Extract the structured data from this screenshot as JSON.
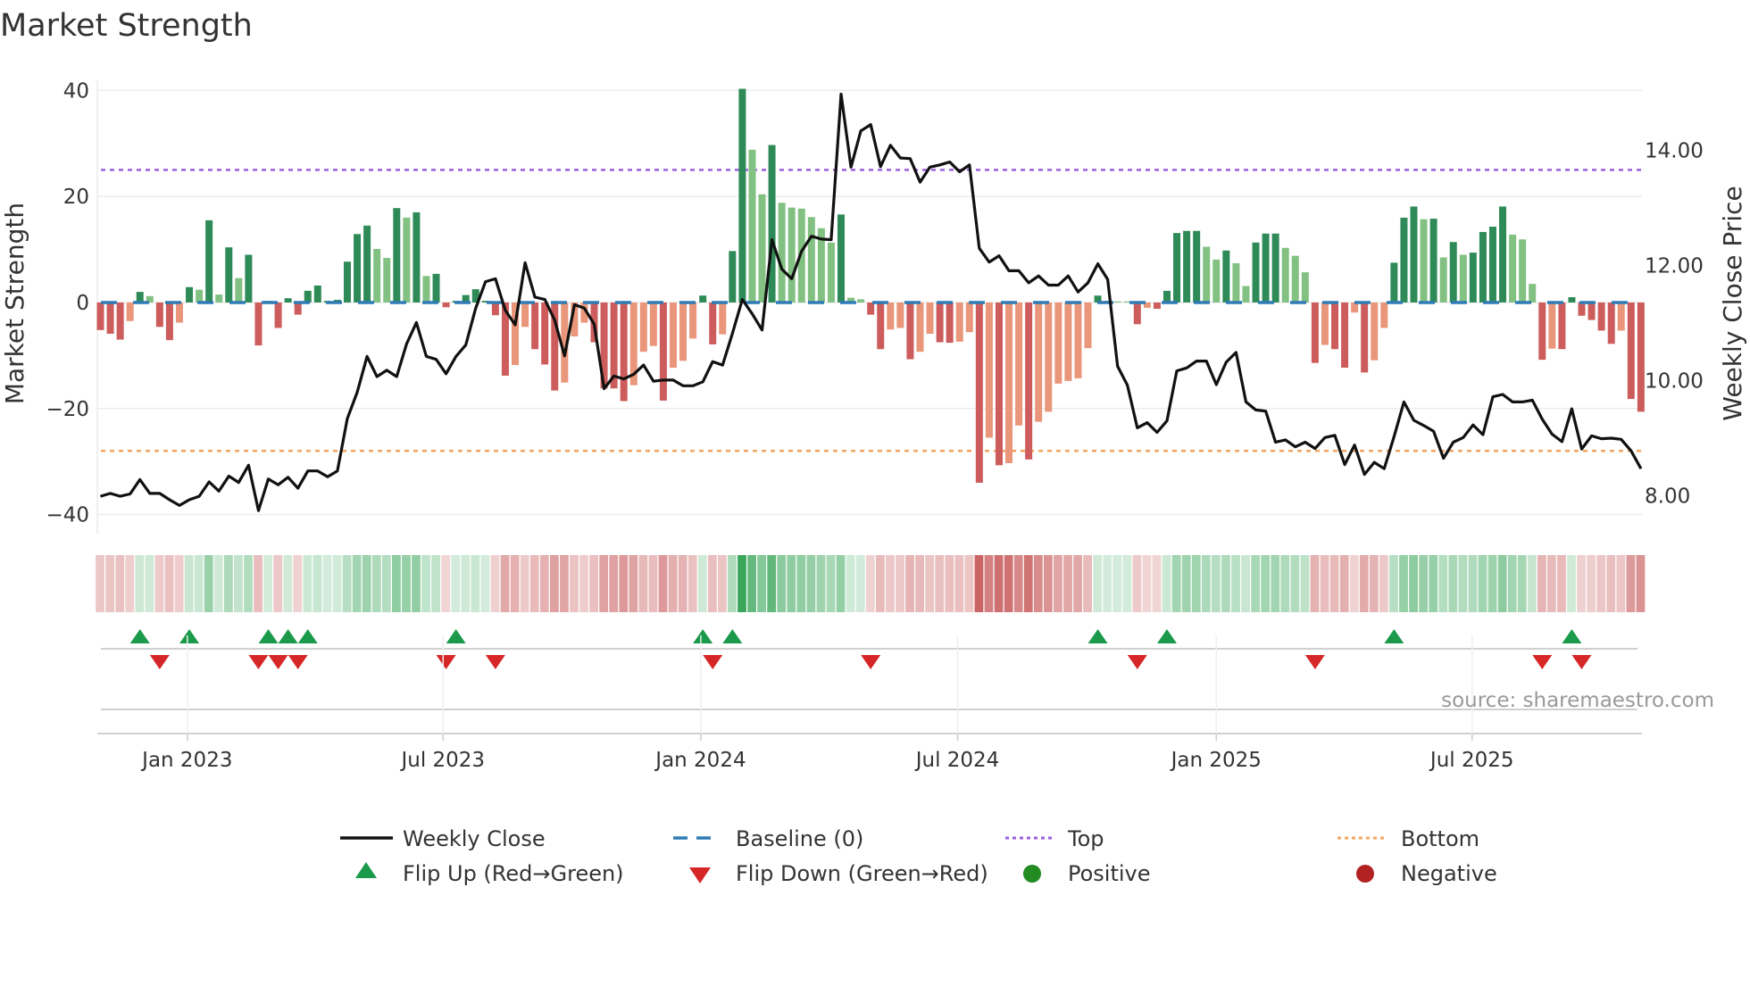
{
  "chart_data": {
    "type": "bar+line",
    "title": "Market Strength",
    "ylabel": "Market Strength",
    "y2label": "Weekly Close Price",
    "ylim": [
      -43.6,
      41.9
    ],
    "y2lim": [
      7.34,
      15.22
    ],
    "yticks": [
      {
        "v": 40,
        "label": "40"
      },
      {
        "v": 20,
        "label": "20"
      },
      {
        "v": 0,
        "label": "0"
      },
      {
        "v": -20,
        "label": "−20"
      },
      {
        "v": -40,
        "label": "−40"
      }
    ],
    "y2ticks": [
      {
        "v": 14,
        "label": "14.00"
      },
      {
        "v": 12,
        "label": "12.00"
      },
      {
        "v": 10,
        "label": "10.00"
      },
      {
        "v": 8,
        "label": "8.00"
      }
    ],
    "x_unit": "week index",
    "xticks": [
      {
        "week": 8.8,
        "label": "Jan 2023"
      },
      {
        "week": 34.7,
        "label": "Jul 2023"
      },
      {
        "week": 60.8,
        "label": "Jan 2024"
      },
      {
        "week": 86.8,
        "label": "Jul 2024"
      },
      {
        "week": 113.0,
        "label": "Jan 2025"
      },
      {
        "week": 138.9,
        "label": "Jul 2025"
      }
    ],
    "top_level": 25,
    "bottom_level": -28,
    "baseline": 0,
    "strength": [
      -5.2,
      -5.9,
      -7,
      -3.5,
      2,
      1.2,
      -4.6,
      -7.1,
      -3.8,
      2.9,
      2.4,
      15.5,
      1.5,
      10.4,
      4.6,
      9,
      -8.1,
      0.3,
      -4.8,
      0.8,
      -2.3,
      2.2,
      3.2,
      0.3,
      0.5,
      7.7,
      12.9,
      14.5,
      10.1,
      8.4,
      17.8,
      16,
      17,
      5,
      5.4,
      -0.9,
      0.3,
      1.4,
      2.5,
      0.3,
      -2.4,
      -13.8,
      -11.8,
      -4.6,
      -8.8,
      -11.7,
      -16.6,
      -15.1,
      -6.4,
      -3.8,
      -7.5,
      -16.2,
      -16.2,
      -18.6,
      -15.6,
      -9.3,
      -8.2,
      -18.5,
      -12.3,
      -11,
      -6.8,
      1.3,
      -7.9,
      -6,
      9.7,
      40.3,
      28.8,
      20.4,
      29.7,
      18.8,
      17.9,
      17.7,
      16.1,
      14,
      11.3,
      16.6,
      0.9,
      0.6,
      -2.3,
      -8.8,
      -5.1,
      -4.8,
      -10.7,
      -9.3,
      -5.9,
      -7.5,
      -7.6,
      -7.4,
      -5.6,
      -34,
      -25.5,
      -30.7,
      -30.3,
      -23.2,
      -29.6,
      -22.5,
      -20.6,
      -15.3,
      -14.8,
      -14.3,
      -8.6,
      1.3,
      0.3,
      0.2,
      0.2,
      -4.1,
      -1,
      -1.2,
      2.2,
      13.1,
      13.5,
      13.5,
      10.5,
      8.1,
      9.8,
      7.4,
      3.1,
      11.3,
      13,
      13,
      10.3,
      8.8,
      5.7,
      -11.4,
      -8,
      -8.8,
      -12.3,
      -1.9,
      -13.2,
      -10.9,
      -4.8,
      7.5,
      16,
      18.1,
      15.7,
      15.8,
      8.5,
      11.4,
      9,
      9.4,
      13.3,
      14.3,
      18.1,
      12.8,
      11.9,
      3.5,
      -10.8,
      -8.7,
      -8.8,
      1,
      -2.5,
      -3.3,
      -5.3,
      -7.8,
      -5.3,
      -18.2,
      -20.6
    ],
    "bar_tones": "RRRrGgRRrGgGgGgGRGRGRGGGGGGGggGgGgGRGGGGRRrrRRRrrrRRRRrrrRrrrGRrGGggGggggggGggRRrrRrrRRrrRrRrrRrrrrrrGGggRrRGGGGggGggGGGgggRrRRrRrrGGGgGgGgGGGGgggRrRGRRRRrRR",
    "weekly_close": [
      7.99,
      8.04,
      7.99,
      8.03,
      8.28,
      8.04,
      8.04,
      7.93,
      7.83,
      7.93,
      7.99,
      8.24,
      8.08,
      8.34,
      8.23,
      8.53,
      7.74,
      8.29,
      8.19,
      8.32,
      8.13,
      8.43,
      8.43,
      8.33,
      8.43,
      9.34,
      9.8,
      10.42,
      10.07,
      10.18,
      10.07,
      10.64,
      11.01,
      10.42,
      10.37,
      10.12,
      10.42,
      10.62,
      11.26,
      11.72,
      11.77,
      11.22,
      10.97,
      12.05,
      11.45,
      11.41,
      11.05,
      10.43,
      11.32,
      11.26,
      10.98,
      9.86,
      10.08,
      10.03,
      10.11,
      10.27,
      9.99,
      10.01,
      10.01,
      9.91,
      9.91,
      9.98,
      10.33,
      10.27,
      10.82,
      11.41,
      11.16,
      10.88,
      12.45,
      11.94,
      11.77,
      12.25,
      12.51,
      12.46,
      12.45,
      14.98,
      13.71,
      14.34,
      14.45,
      13.72,
      14.09,
      13.87,
      13.86,
      13.45,
      13.71,
      13.75,
      13.8,
      13.63,
      13.75,
      12.3,
      12.06,
      12.17,
      11.91,
      11.91,
      11.7,
      11.82,
      11.66,
      11.66,
      11.82,
      11.54,
      11.7,
      12.03,
      11.76,
      10.25,
      9.92,
      9.18,
      9.27,
      9.1,
      9.3,
      10.17,
      10.22,
      10.34,
      10.34,
      9.93,
      10.32,
      10.49,
      9.63,
      9.49,
      9.47,
      8.93,
      8.97,
      8.85,
      8.93,
      8.82,
      9.01,
      9.05,
      8.54,
      8.88,
      8.37,
      8.58,
      8.47,
      9.03,
      9.63,
      9.31,
      9.22,
      9.12,
      8.65,
      8.93,
      9.01,
      9.23,
      9.06,
      9.72,
      9.76,
      9.63,
      9.63,
      9.66,
      9.33,
      9.07,
      8.94,
      9.51,
      8.81,
      9.04,
      8.99,
      9.0,
      8.98,
      8.78,
      8.47
    ],
    "flip_up_weeks": [
      4,
      9,
      17,
      19,
      21,
      36,
      61,
      64,
      101,
      108,
      131,
      149
    ],
    "flip_down_weeks": [
      6,
      16,
      18,
      20,
      35,
      40,
      62,
      78,
      105,
      123,
      146,
      150
    ],
    "legend": {
      "placement": "bottom",
      "items": [
        {
          "key": "close",
          "label": "Weekly Close"
        },
        {
          "key": "baseline",
          "label": "Baseline (0)"
        },
        {
          "key": "top",
          "label": "Top"
        },
        {
          "key": "bottom",
          "label": "Bottom"
        },
        {
          "key": "flip_up",
          "label": "Flip Up (Red→Green)"
        },
        {
          "key": "flip_down",
          "label": "Flip Down (Green→Red)"
        },
        {
          "key": "positive",
          "label": "Positive"
        },
        {
          "key": "negative",
          "label": "Negative"
        }
      ]
    },
    "source": "source: sharemaestro.com",
    "grid": true
  },
  "colors": {
    "pos_strong": "#2e8b57",
    "pos_weak": "#82c182",
    "neg_strong": "#cd5c5c",
    "neg_weak": "#e9967a",
    "close": "#111111",
    "baseline": "#2f7bb5",
    "top": "#9b5fe0",
    "bottom": "#f2a45f",
    "flip_up": "#1a9a4a",
    "flip_down": "#d62728",
    "positive": "#228b22",
    "negative": "#b22222",
    "strip_pos": "#3aa65a",
    "strip_neg": "#c45050"
  }
}
